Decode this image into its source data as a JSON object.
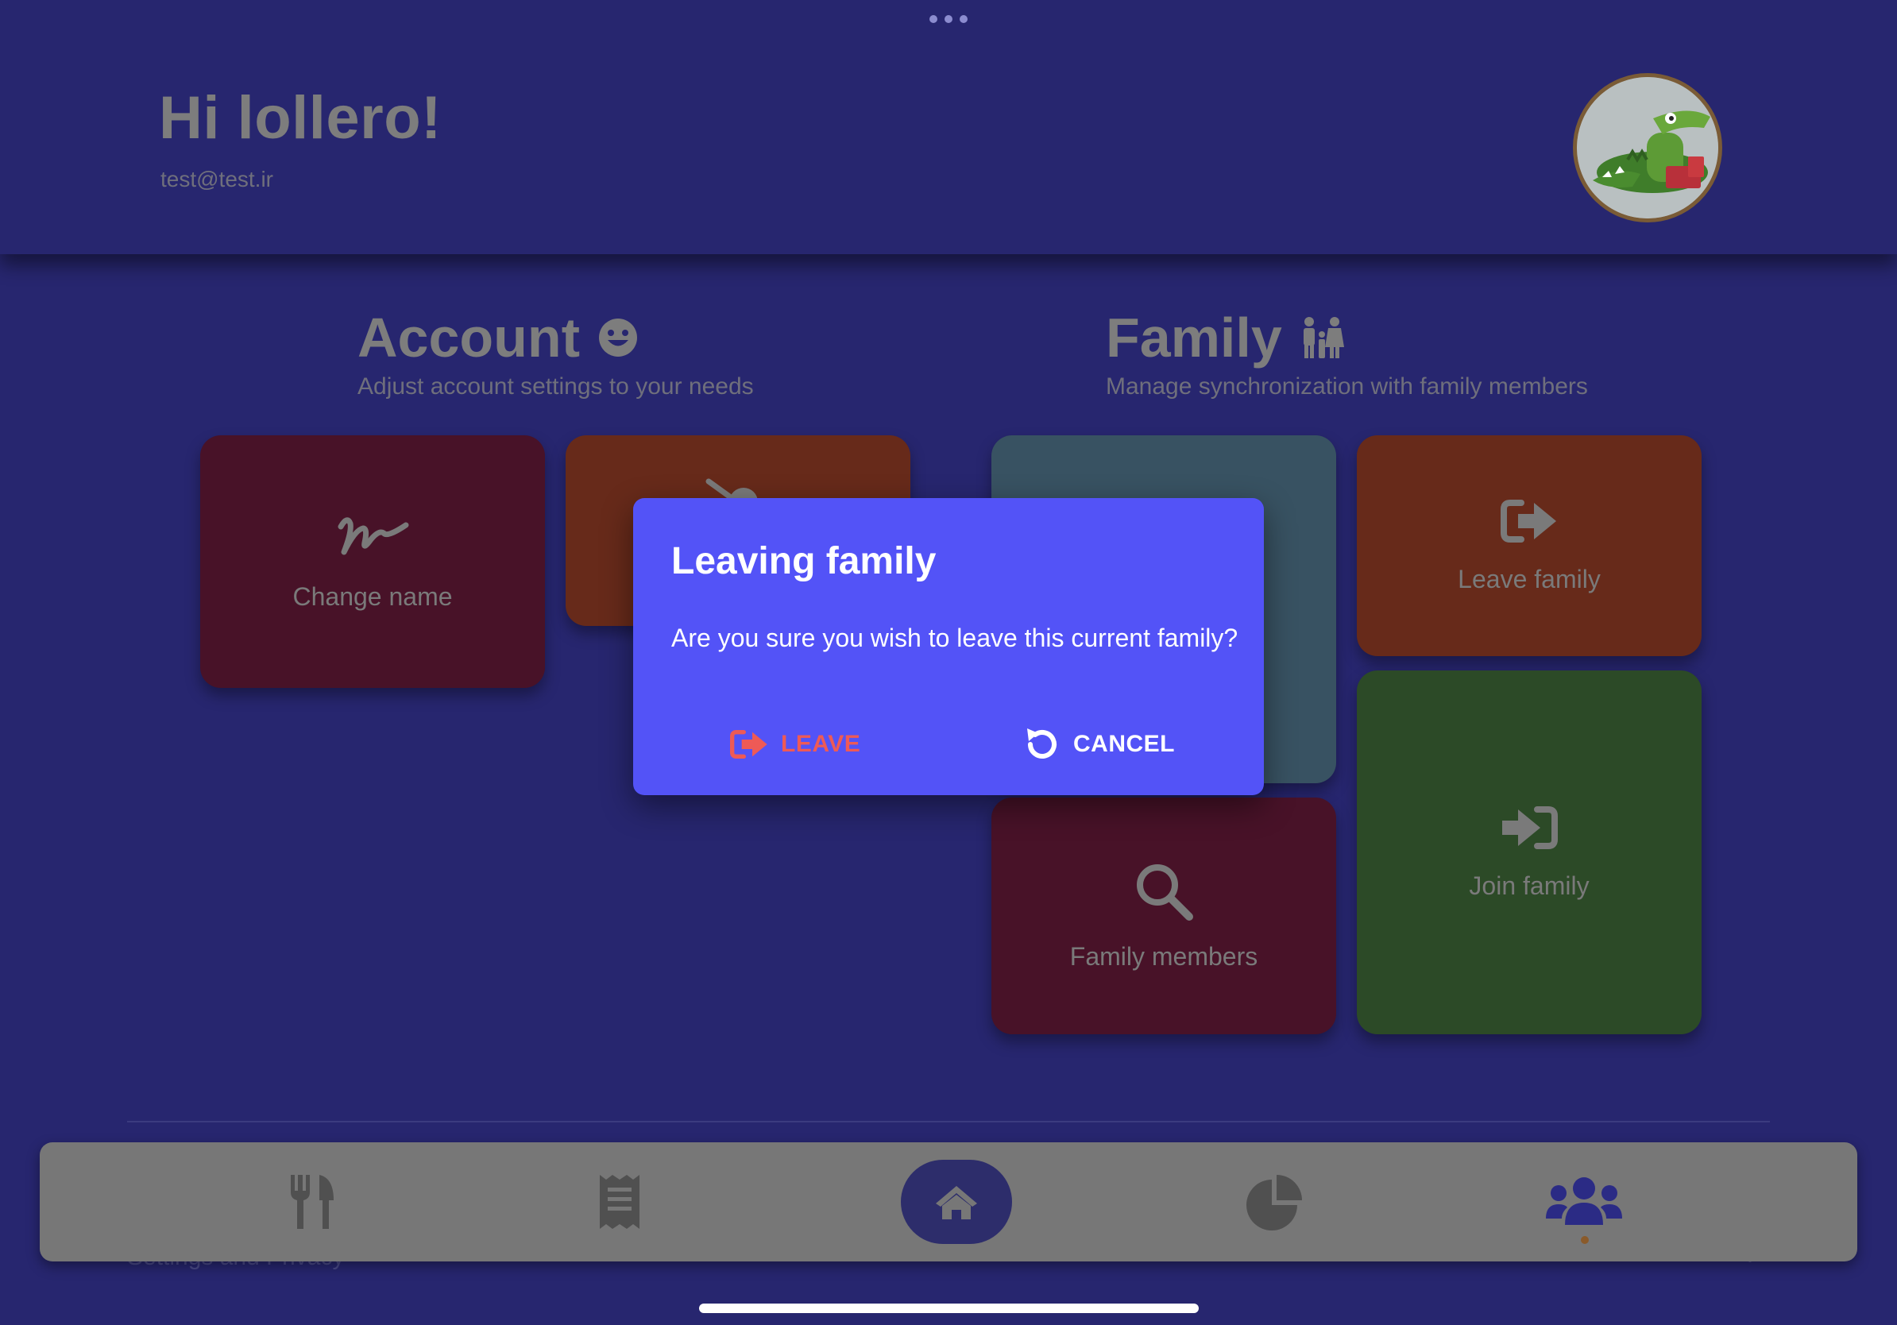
{
  "header": {
    "greeting": "Hi lollero!",
    "email": "test@test.ir",
    "avatar_icon": "crocodile-avatar"
  },
  "account": {
    "title": "Account",
    "subtitle": "Adjust account settings to your needs",
    "icon": "grin-face-icon",
    "tiles": [
      {
        "label": "Change name",
        "icon": "signature-icon",
        "color": "#481228"
      },
      {
        "label": "",
        "icon": "partially-covered-icon",
        "color": "#672a1a"
      }
    ]
  },
  "family": {
    "title": "Family",
    "subtitle": "Manage synchronization with family members",
    "icon": "family-icon",
    "tiles": [
      {
        "label": "",
        "color": "#385262"
      },
      {
        "label": "Leave family",
        "icon": "sign-out-icon",
        "color": "#672a1a"
      },
      {
        "label": "Family members",
        "icon": "search-icon",
        "color": "#481228"
      },
      {
        "label": "Join family",
        "icon": "sign-in-icon",
        "color": "#2c4a27"
      }
    ]
  },
  "settings": {
    "label": "Settings and Privacy"
  },
  "bottom_nav": {
    "items": [
      {
        "name": "meals",
        "icon": "utensils-icon",
        "active": false
      },
      {
        "name": "receipts",
        "icon": "receipt-icon",
        "active": false
      },
      {
        "name": "home",
        "icon": "home-icon",
        "active": false
      },
      {
        "name": "stats",
        "icon": "pie-chart-icon",
        "active": false
      },
      {
        "name": "family",
        "icon": "users-icon",
        "active": true
      }
    ]
  },
  "dialog": {
    "title": "Leaving family",
    "message": "Are you sure you wish to leave this current family?",
    "leave_label": "LEAVE",
    "cancel_label": "CANCEL",
    "leave_color": "#ee5a56",
    "background": "#5353f7"
  },
  "colors": {
    "background": "#27266f",
    "nav_bar": "#777777",
    "home_pill": "#2d2d6b",
    "active_icon": "#2b2b85"
  }
}
